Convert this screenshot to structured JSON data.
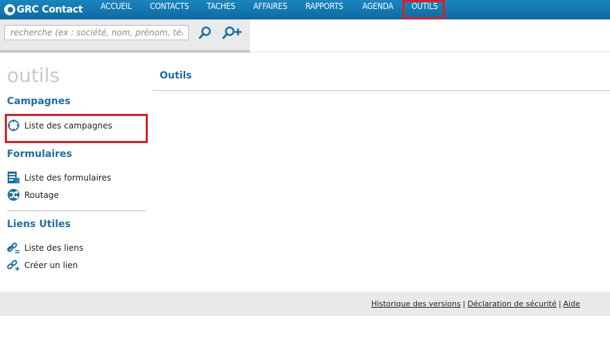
{
  "app": {
    "logo_text": "GRC Contact"
  },
  "nav": {
    "items": [
      {
        "label": "ACCUEIL"
      },
      {
        "label": "CONTACTS"
      },
      {
        "label": "TACHES"
      },
      {
        "label": "AFFAIRES"
      },
      {
        "label": "RAPPORTS"
      },
      {
        "label": "AGENDA"
      },
      {
        "label": "OUTILS"
      }
    ],
    "active": "OUTILS"
  },
  "search": {
    "placeholder": "recherche (ex : société, nom, prénom, tél., e",
    "search_icon": "magnifier-icon",
    "add_icon": "magnifier-plus-icon"
  },
  "sidebar": {
    "page_title": "outils",
    "sections": [
      {
        "title": "Campagnes",
        "links": [
          {
            "label": "Liste des campagnes",
            "icon": "crosshair-icon"
          }
        ]
      },
      {
        "title": "Formulaires",
        "links": [
          {
            "label": "Liste des formulaires",
            "icon": "form-icon"
          },
          {
            "label": "Routage",
            "icon": "shuffle-icon"
          }
        ]
      },
      {
        "title": "Liens Utiles",
        "links": [
          {
            "label": "Liste des liens",
            "icon": "link-list-icon"
          },
          {
            "label": "Créer un lien",
            "icon": "link-add-icon"
          }
        ]
      }
    ]
  },
  "main": {
    "title": "Outils"
  },
  "footer": {
    "links": [
      {
        "label": "Historique des versions"
      },
      {
        "label": "Déclaration de sécurité"
      },
      {
        "label": "Aide"
      }
    ],
    "separator": "|"
  },
  "colors": {
    "nav_bg": "#1379b0",
    "accent": "#1c6fa3",
    "highlight": "#e11b22",
    "footer_bg": "#e9e9e9"
  }
}
